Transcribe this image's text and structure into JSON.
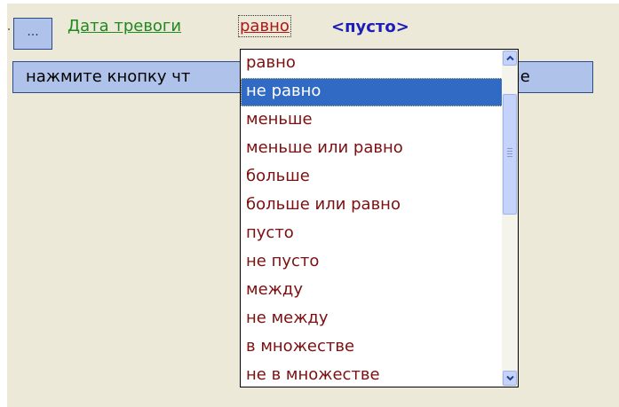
{
  "condition": {
    "ellipsis_label": "...",
    "field_label": "Дата тревоги",
    "operator_label": "равно",
    "value_label": "<пусто>"
  },
  "hint": {
    "left_text": "нажмите кнопку чт",
    "right_text": "овие"
  },
  "dropdown": {
    "selected_index": 1,
    "options": [
      "равно",
      "не равно",
      "меньше",
      "меньше или равно",
      "больше",
      "больше или равно",
      "пусто",
      "не пусто",
      "между",
      "не между",
      "в множестве",
      "не в множестве"
    ]
  },
  "colors": {
    "field_link": "#1e8a1e",
    "operator_link": "#b01515",
    "value_link": "#1c1cb8",
    "option_text": "#7a1010",
    "selection": "#316ac5",
    "button_fill": "#aec2ea"
  },
  "icons": {
    "scroll_up": "chevron-up-icon",
    "scroll_down": "chevron-down-icon",
    "thumb_grip": "grip-icon"
  }
}
